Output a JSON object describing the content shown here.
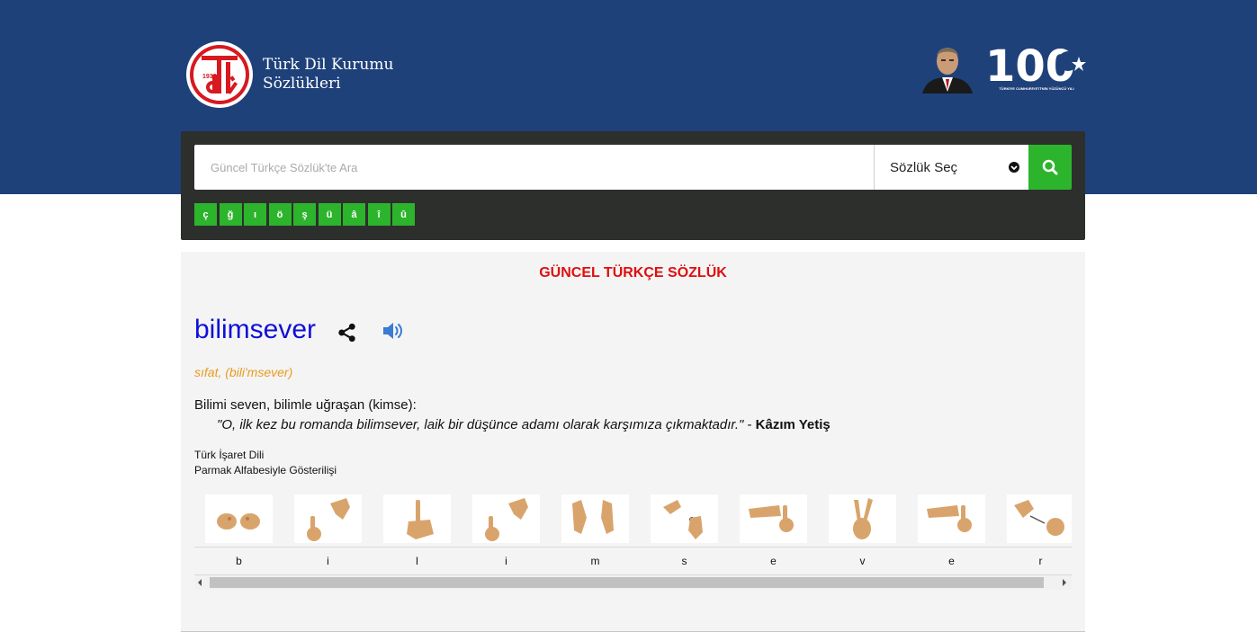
{
  "header": {
    "logo": {
      "seal_year": "1932",
      "seal_letters": "TDK"
    },
    "title_line1": "Türk Dil Kurumu",
    "title_line2": "Sözlükleri",
    "anniversary": {
      "number": "100",
      "caption": "TÜRKİYE CUMHURİYETİ'NİN YÜZÜNCÜ YILI"
    }
  },
  "search": {
    "placeholder": "Güncel Türkçe Sözlük'te Ara",
    "value": "",
    "dict_select_label": "Sözlük Seç",
    "special_chars": [
      "ç",
      "ğ",
      "ı",
      "ö",
      "ş",
      "ü",
      "â",
      "î",
      "û"
    ]
  },
  "result": {
    "dictionary_title": "GÜNCEL TÜRKÇE SÖZLÜK",
    "word": "bilimsever",
    "part_of_speech": "sıfat, (bili'msever)",
    "definition": "Bilimi seven, bilimle uğraşan (kimse):",
    "example_quote": "\"O, ilk kez bu romanda bilimsever, laik bir düşünce adamı olarak karşımıza çıkmaktadır.\"",
    "example_separator": " - ",
    "example_author": "Kâzım Yetiş"
  },
  "sign_language": {
    "title_line1": "Türk İşaret Dili",
    "title_line2": "Parmak Alfabesiyle Gösterilişi",
    "letters": [
      "b",
      "i",
      "l",
      "i",
      "m",
      "s",
      "e",
      "v",
      "e",
      "r"
    ]
  },
  "colors": {
    "header_bg": "#1f417a",
    "search_panel_bg": "#2d2f2c",
    "accent_green": "#2db42d",
    "dict_title_red": "#e10e0e",
    "word_blue": "#1010d8",
    "pos_orange": "#e89b1e",
    "content_bg": "#f4f4f4",
    "skin": "#d9a46c"
  },
  "icons": {
    "search": "search-icon",
    "share": "share-icon",
    "sound": "speaker-icon",
    "select": "chevron-down-icon"
  }
}
